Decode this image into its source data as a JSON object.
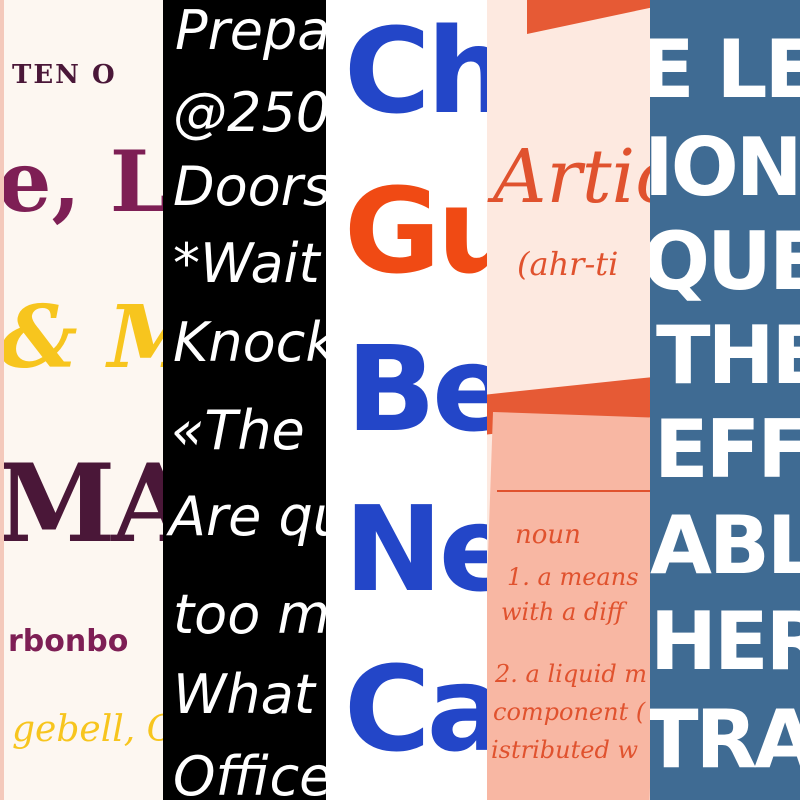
{
  "colors": {
    "maroon": "#7e1f55",
    "plum": "#4a1738",
    "yellow": "#f7c51e",
    "cobalt": "#2346c8",
    "vermilion": "#f04a14",
    "coral": "#e0522e",
    "slate": "#3f6b93"
  },
  "strip1": {
    "line1": "TEN O",
    "line2": "e, L",
    "line3": "& M",
    "line4": "MAL",
    "line5": "rbonbo",
    "line6": "gebell, C"
  },
  "strip2": {
    "lines": [
      "Prepa",
      "@250",
      "Doors",
      "*Wait",
      "Knock",
      "«The",
      "Are qu",
      "too m",
      "What",
      "Office"
    ]
  },
  "strip3": {
    "lines": [
      "Ch",
      "Gu",
      "Be",
      "Ne",
      "Ca"
    ]
  },
  "strip4": {
    "heading": "Artic",
    "pronunciation": "(ahr-ti",
    "pos": "noun",
    "def1_line1": "1. a means",
    "def1_line2": "with a diff",
    "def2_line1": "2. a liquid m",
    "def2_line2": "component (",
    "def2_line3": "istributed w"
  },
  "strip5": {
    "lines": [
      "E LEAT",
      "IONAL",
      "QUES.",
      "THE LI",
      "EFFEC",
      "ABLE-",
      "HER SE",
      "TRAST"
    ]
  }
}
